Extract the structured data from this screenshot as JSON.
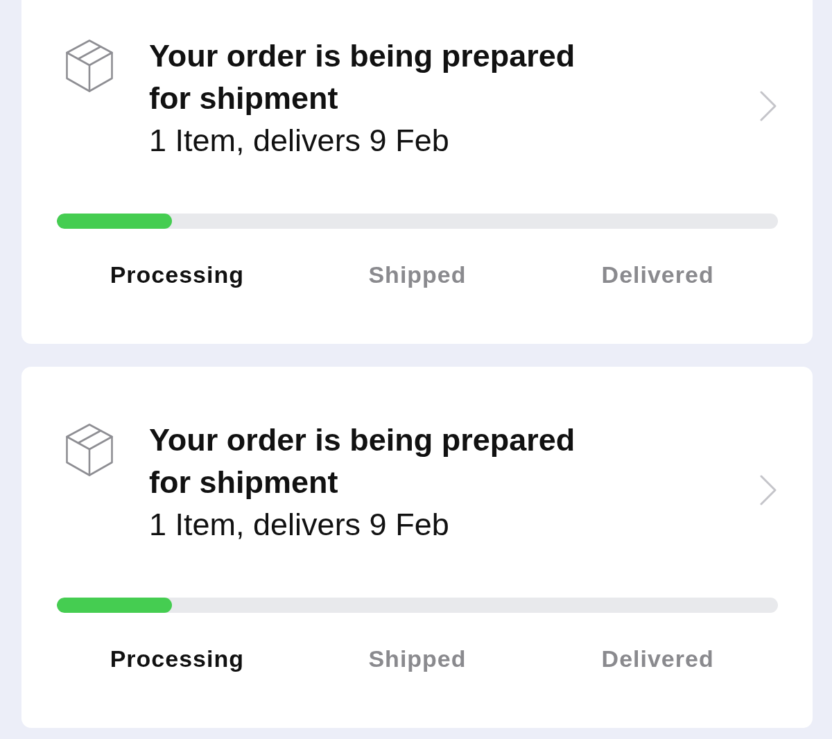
{
  "orders": [
    {
      "title": "Your order is being prepared for shipment",
      "subtitle": "1 Item, delivers 9 Feb",
      "progress": {
        "level": 0.16
      },
      "steps": [
        {
          "label": "Processing",
          "active": true
        },
        {
          "label": "Shipped",
          "active": false
        },
        {
          "label": "Delivered",
          "active": false
        }
      ]
    },
    {
      "title": "Your order is being prepared for shipment",
      "subtitle": "1 Item, delivers 9 Feb",
      "progress": {
        "level": 0.16
      },
      "steps": [
        {
          "label": "Processing",
          "active": true
        },
        {
          "label": "Shipped",
          "active": false
        },
        {
          "label": "Delivered",
          "active": false
        }
      ]
    }
  ]
}
